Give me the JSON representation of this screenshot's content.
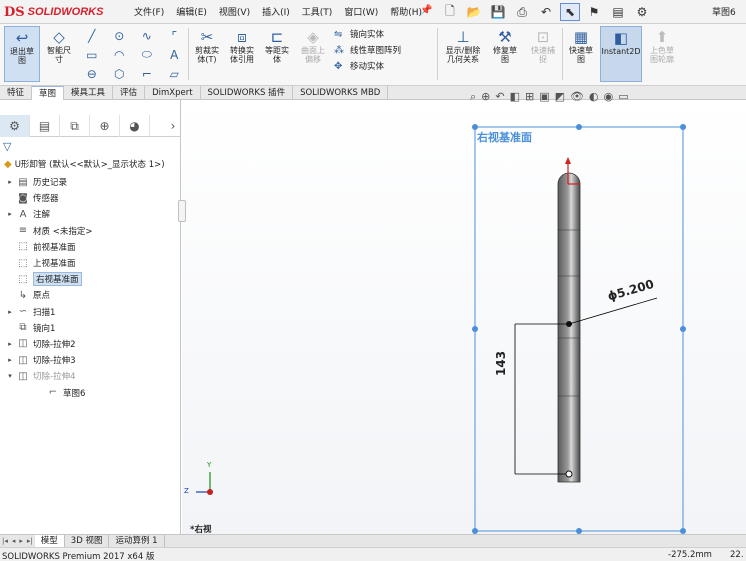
{
  "app": {
    "brand_mark": "DS",
    "brand_name": "SOLIDWORKS",
    "document_title": "草图6"
  },
  "menu": [
    "文件(F)",
    "编辑(E)",
    "视图(V)",
    "插入(I)",
    "工具(T)",
    "窗口(W)",
    "帮助(H)"
  ],
  "ribbon": {
    "exit_sketch": "退出草\n图",
    "smart_dim": "智能尺\n寸",
    "trim": "剪裁实\n体(T)",
    "convert": "转换实\n体引用",
    "offset": "等距实\n体",
    "surface_offset": "曲面上\n偏移",
    "mirror": "镜向实体",
    "linear_pattern": "线性草图阵列",
    "move": "移动实体",
    "display_relations": "显示/删除\n几何关系",
    "repair": "修复草\n图",
    "quick_snap": "快速捕\n捉",
    "quick_sketch": "快速草\n图",
    "instant2d": "Instant2D",
    "shaded_contour": "上色草\n图轮廓"
  },
  "tabs": [
    "特征",
    "草图",
    "模具工具",
    "评估",
    "DimXpert",
    "SOLIDWORKS 插件",
    "SOLIDWORKS MBD"
  ],
  "tree": {
    "root": "U形卸管  (默认<<默认>_显示状态 1>)",
    "items": [
      {
        "label": "历史记录",
        "icon": "history-icon",
        "glyph": "▤",
        "tog": "▸"
      },
      {
        "label": "传感器",
        "icon": "sensor-icon",
        "glyph": "◙",
        "tog": ""
      },
      {
        "label": "注解",
        "icon": "annotation-icon",
        "glyph": "A",
        "tog": "▸"
      },
      {
        "label": "材质 <未指定>",
        "icon": "material-icon",
        "glyph": "≡",
        "tog": ""
      },
      {
        "label": "前视基准面",
        "icon": "plane-icon",
        "glyph": "⬚",
        "tog": ""
      },
      {
        "label": "上视基准面",
        "icon": "plane-icon",
        "glyph": "⬚",
        "tog": ""
      },
      {
        "label": "右视基准面",
        "icon": "plane-icon",
        "glyph": "⬚",
        "tog": ""
      },
      {
        "label": "原点",
        "icon": "origin-icon",
        "glyph": "↳",
        "tog": ""
      },
      {
        "label": "扫描1",
        "icon": "sweep-icon",
        "glyph": "∽",
        "tog": "▸"
      },
      {
        "label": "镜向1",
        "icon": "mirror-icon",
        "glyph": "⧉",
        "tog": ""
      },
      {
        "label": "切除-拉伸2",
        "icon": "cut-extrude-icon",
        "glyph": "◫",
        "tog": "▸"
      },
      {
        "label": "切除-拉伸3",
        "icon": "cut-extrude-icon",
        "glyph": "◫",
        "tog": "▸"
      },
      {
        "label": "切除-拉伸4",
        "icon": "cut-extrude-icon",
        "glyph": "◫",
        "tog": "▾"
      },
      {
        "label": "草图6",
        "icon": "sketch-icon",
        "glyph": "⌐",
        "tog": ""
      }
    ]
  },
  "viewport": {
    "plane_label": "右视基准面",
    "dim_diameter": "ϕ5.200",
    "dim_length": "143",
    "view_name": "*右视",
    "axis_x": "Z",
    "axis_y": "Y"
  },
  "bottom_tabs": [
    "模型",
    "3D 视图",
    "运动算例 1"
  ],
  "status": {
    "version": "SOLIDWORKS Premium 2017 x64 版",
    "coord": "-275.2mm",
    "extra": "22."
  },
  "colors": {
    "accent": "#2f5f9e",
    "selection": "#4a90d9",
    "brand": "#d6202b"
  }
}
